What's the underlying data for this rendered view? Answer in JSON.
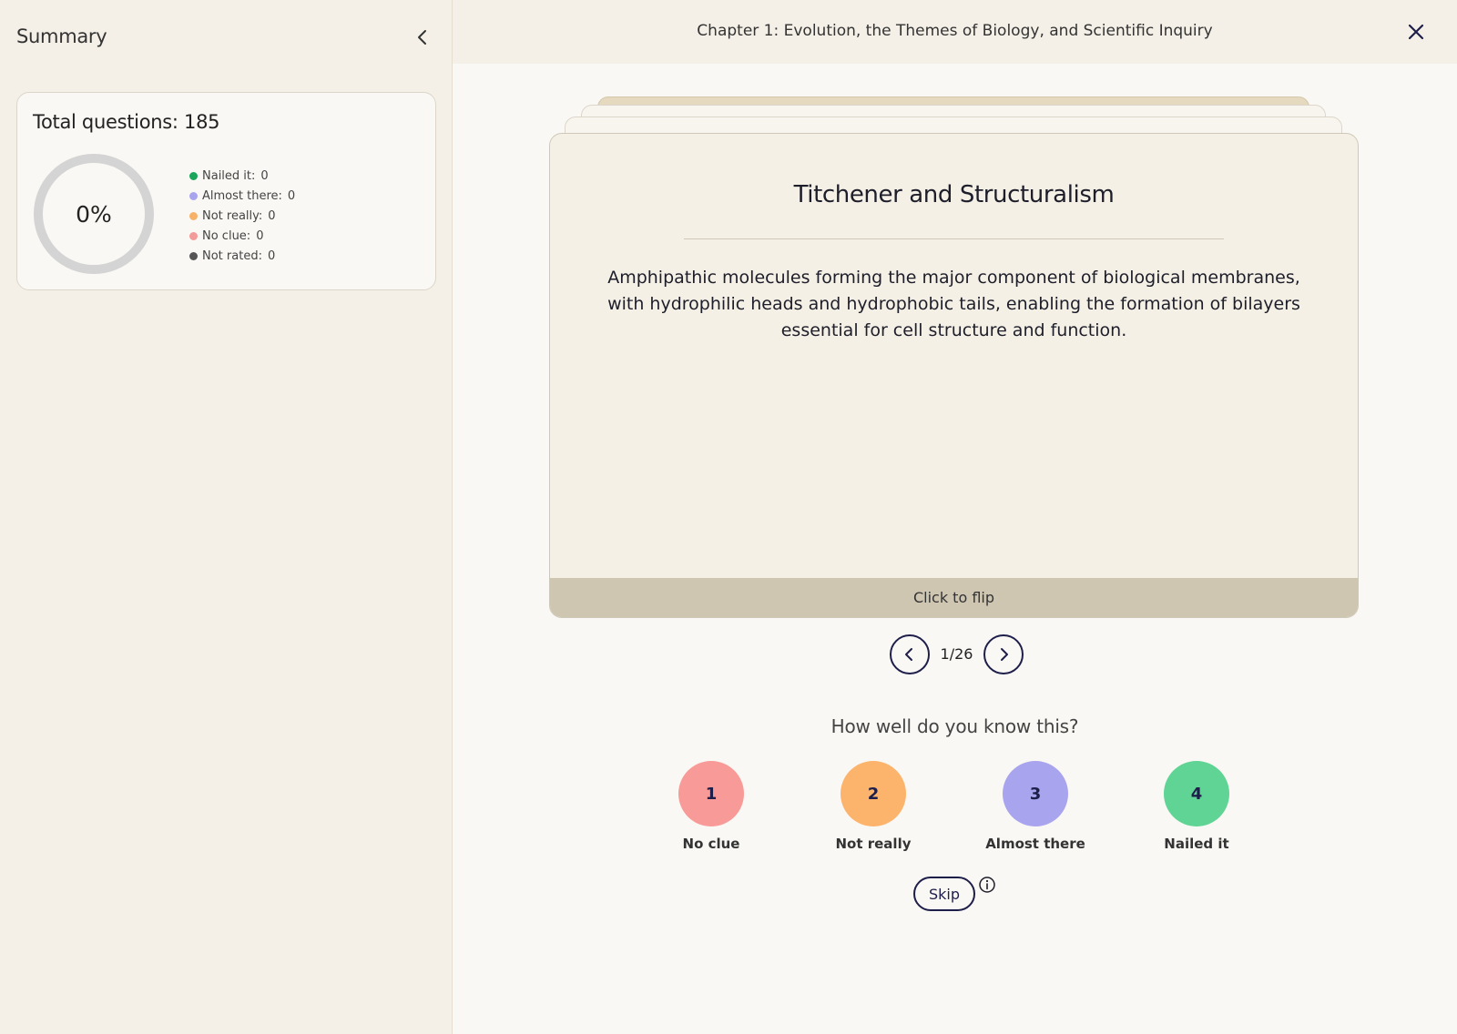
{
  "sidebar": {
    "title": "Summary",
    "total_questions_label": "Total questions: 185",
    "progress_percent": 0,
    "progress_label": "0%",
    "legend": [
      {
        "label": "Nailed it:",
        "count": "0",
        "color": "#1aa55a"
      },
      {
        "label": "Almost there:",
        "count": "0",
        "color": "#a9a4ee"
      },
      {
        "label": "Not really:",
        "count": "0",
        "color": "#f7b26a"
      },
      {
        "label": "No clue:",
        "count": "0",
        "color": "#f39a9a"
      },
      {
        "label": "Not rated:",
        "count": "0",
        "color": "#555555"
      }
    ]
  },
  "header": {
    "chapter_title": "Chapter 1: Evolution, the Themes of Biology, and Scientific Inquiry"
  },
  "card": {
    "title": "Titchener and Structuralism",
    "text": "Amphipathic molecules forming the major component of biological membranes, with hydrophilic heads and hydrophobic tails, enabling the formation of bilayers essential for cell structure and function.",
    "flip_label": "Click to flip"
  },
  "pagination": {
    "current": "1/26"
  },
  "rating": {
    "prompt": "How well do you know this?",
    "options": [
      {
        "number": "1",
        "label": "No clue",
        "color": "#f89a98"
      },
      {
        "number": "2",
        "label": "Not really",
        "color": "#fcb46c"
      },
      {
        "number": "3",
        "label": "Almost there",
        "color": "#a9a4ee"
      },
      {
        "number": "4",
        "label": "Nailed it",
        "color": "#5fd494"
      }
    ],
    "skip_label": "Skip"
  },
  "colors": {
    "accent_dark": "#1e1e4a",
    "sidebar_bg": "#f4f0e7",
    "card_bg": "#f4f0e6",
    "flip_bar_bg": "#cfc6b2"
  }
}
